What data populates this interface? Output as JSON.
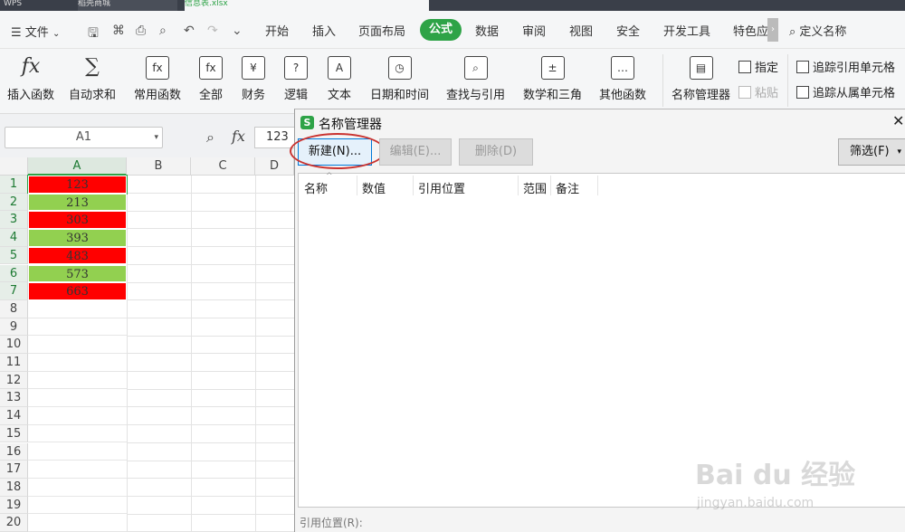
{
  "titlebar": {
    "tabs": [
      {
        "label": "WPS"
      },
      {
        "label": "稻壳商城"
      },
      {
        "label": "信息表.xlsx"
      }
    ]
  },
  "menubar": {
    "file_label": "文件",
    "items": [
      "开始",
      "插入",
      "页面布局",
      "公式",
      "数据",
      "审阅",
      "视图",
      "安全",
      "开发工具",
      "特色应"
    ],
    "active_item": "公式",
    "search_label": "定义名称"
  },
  "ribbon": {
    "buttons": [
      {
        "label": "插入函数",
        "icon": "fx-icon",
        "glyph": "fx"
      },
      {
        "label": "自动求和",
        "icon": "sigma-icon",
        "glyph": "∑"
      },
      {
        "label": "常用函数",
        "icon": "common-function-icon",
        "glyph": "fx"
      },
      {
        "label": "全部",
        "icon": "all-functions-icon",
        "glyph": "fx"
      },
      {
        "label": "财务",
        "icon": "finance-icon",
        "glyph": "¥"
      },
      {
        "label": "逻辑",
        "icon": "logic-icon",
        "glyph": "?"
      },
      {
        "label": "文本",
        "icon": "text-icon",
        "glyph": "A"
      },
      {
        "label": "日期和时间",
        "icon": "clock-icon",
        "glyph": "◷"
      },
      {
        "label": "查找与引用",
        "icon": "lookup-icon",
        "glyph": "⌕"
      },
      {
        "label": "数学和三角",
        "icon": "math-icon",
        "glyph": "±"
      },
      {
        "label": "其他函数",
        "icon": "more-functions-icon",
        "glyph": "…"
      },
      {
        "label": "名称管理器",
        "icon": "name-manager-icon",
        "glyph": "▤"
      }
    ],
    "small_buttons": {
      "assign": "指定",
      "paste": "粘贴",
      "trace_precedents": "追踪引用单元格",
      "trace_dependents": "追踪从属单元格"
    }
  },
  "formula_bar": {
    "name_box": "A1",
    "fx_label": "fx",
    "value": "123"
  },
  "sheet": {
    "columns": [
      "A",
      "B",
      "C",
      "D"
    ],
    "rows": [
      "1",
      "2",
      "3",
      "4",
      "5",
      "6",
      "7",
      "8",
      "9",
      "10",
      "11",
      "12",
      "13",
      "14",
      "15",
      "16",
      "17",
      "18",
      "19",
      "20"
    ],
    "cells": [
      {
        "value": "123",
        "fill": "#ff0000"
      },
      {
        "value": "213",
        "fill": "#92d050"
      },
      {
        "value": "303",
        "fill": "#ff0000"
      },
      {
        "value": "393",
        "fill": "#92d050"
      },
      {
        "value": "483",
        "fill": "#ff0000"
      },
      {
        "value": "573",
        "fill": "#92d050"
      },
      {
        "value": "663",
        "fill": "#ff0000"
      }
    ]
  },
  "dialog": {
    "title": "名称管理器",
    "buttons": {
      "new": "新建(N)...",
      "edit": "编辑(E)...",
      "delete": "删除(D)",
      "filter": "筛选(F)"
    },
    "columns": [
      "名称",
      "数值",
      "引用位置",
      "范围",
      "备注"
    ],
    "ref_label": "引用位置(R):"
  },
  "watermark": {
    "main": "Bai du 经验",
    "sub": "jingyan.baidu.com"
  },
  "colors": {
    "accent": "#2ea347",
    "red_fill": "#ff0000",
    "green_fill": "#92d050",
    "highlight_ring": "#c9322f"
  }
}
